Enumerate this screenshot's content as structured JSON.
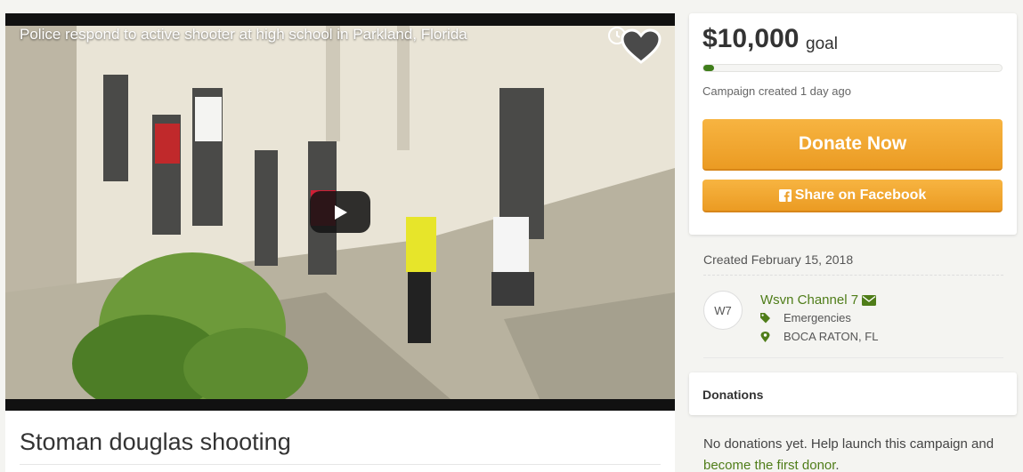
{
  "video": {
    "title": "Police respond to active shooter at high school in Parkland, Florida",
    "icons": [
      "watch-later-icon",
      "heart-icon",
      "play-icon"
    ]
  },
  "campaign": {
    "title": "Stoman douglas shooting"
  },
  "goal": {
    "amount": "$10,000",
    "label": "goal",
    "progress_fraction": 0.0,
    "created_ago": "Campaign created 1 day ago"
  },
  "buttons": {
    "donate": "Donate Now",
    "share": "Share on Facebook"
  },
  "details": {
    "created": "Created February 15, 2018",
    "avatar_initials": "W7",
    "organizer": "Wsvn Channel 7",
    "category": "Emergencies",
    "location": "BOCA RATON, FL"
  },
  "donations": {
    "heading": "Donations",
    "empty_text": "No donations yet. Help launch this campaign and ",
    "cta_link": "become the first donor",
    "trailing": "."
  },
  "colors": {
    "accent_green": "#4f7d19",
    "button_orange": "#f0a530",
    "page_background": "#f4f4f1"
  }
}
